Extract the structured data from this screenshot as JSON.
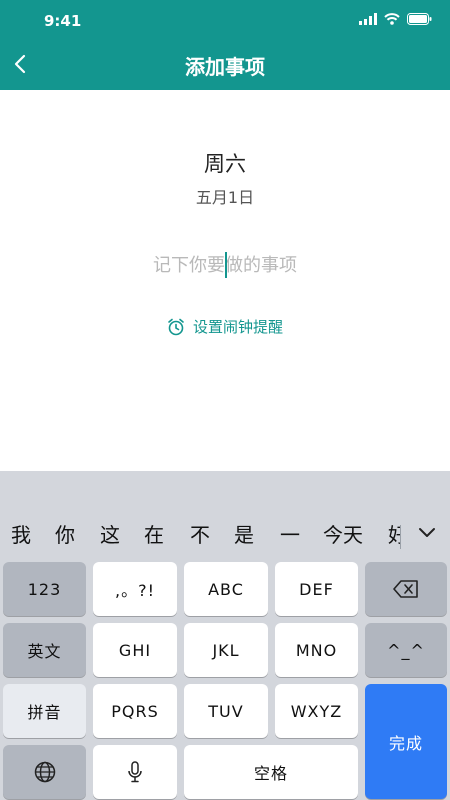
{
  "status_bar": {
    "time": "9:41"
  },
  "nav": {
    "title": "添加事项"
  },
  "content": {
    "weekday": "周六",
    "date": "五月1日",
    "input_placeholder": "记下你要做的事项",
    "alarm_label": "设置闹钟提醒"
  },
  "keyboard": {
    "candidates": [
      "我",
      "你",
      "这",
      "在",
      "不",
      "是",
      "一",
      "今天",
      "好"
    ],
    "keys": {
      "num": "123",
      "punct": ",。?!",
      "abc": "ABC",
      "def": "DEF",
      "english": "英文",
      "ghi": "GHI",
      "jkl": "JKL",
      "mno": "MNO",
      "emoji": "^_^",
      "pinyin": "拼音",
      "pqrs": "PQRS",
      "tuv": "TUV",
      "wxyz": "WXYZ",
      "done": "完成",
      "space": "空格"
    }
  },
  "colors": {
    "header": "#13968f",
    "accent": "#13968f",
    "done_key": "#2f7bf5"
  }
}
